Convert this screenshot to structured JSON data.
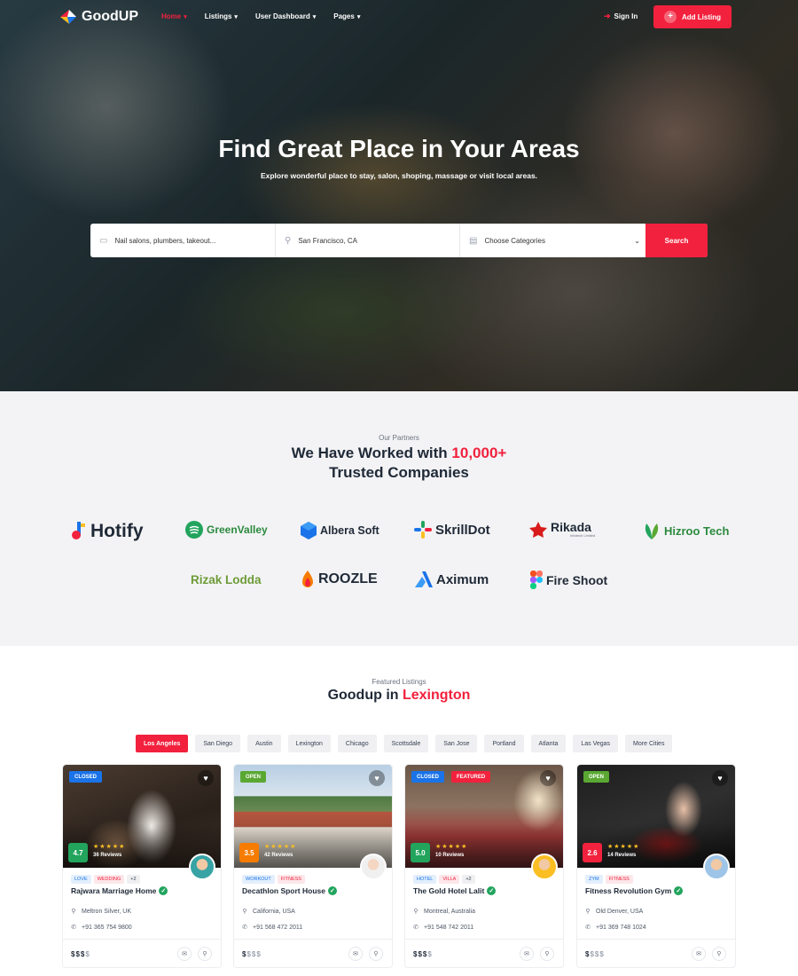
{
  "brand": {
    "name": "GoodUP"
  },
  "nav": {
    "items": [
      {
        "label": "Home",
        "active": true
      },
      {
        "label": "Listings"
      },
      {
        "label": "User Dashboard"
      },
      {
        "label": "Pages"
      }
    ],
    "signin": "Sign In",
    "add_listing": "Add Listing"
  },
  "hero": {
    "title": "Find Great Place in Your Areas",
    "subtitle": "Explore wonderful place to stay, salon, shoping, massage or visit local areas.",
    "search": {
      "keyword_placeholder": "Nail salons, plumbers, takeout...",
      "location_placeholder": "San Francisco, CA",
      "category_selected": "Choose Categories",
      "button": "Search"
    }
  },
  "partners": {
    "kicker": "Our Partners",
    "title_line1": "We Have Worked with ",
    "title_highlight": "10,000+",
    "title_line2": "Trusted Companies",
    "logos": [
      "Hotify",
      "GreenValley",
      "Albera Soft",
      "SkrillDot",
      "Rikada",
      "Hizroo Tech",
      "Rizak Lodda",
      "ROOZLE",
      "Aximum",
      "Fire Shoot"
    ],
    "rikada_sub": "Infotech Limited"
  },
  "featured": {
    "kicker": "Featured Listings",
    "title_prefix": "Goodup in ",
    "title_highlight": "Lexington",
    "tabs": [
      "Los Angeles",
      "San Diego",
      "Austin",
      "Lexington",
      "Chicago",
      "Scottsdale",
      "San Jose",
      "Portland",
      "Atlanta",
      "Las Vegas",
      "More Cities"
    ],
    "active_tab": "Los Angeles",
    "cards": [
      {
        "status": "CLOSED",
        "featured": null,
        "rating": "4.7",
        "stars": 5,
        "reviews": "36 Reviews",
        "tags": [
          "LOVE",
          "WEDDING",
          "+2"
        ],
        "name": "Rajwara Marriage Home",
        "location": "Meltron Silver, UK",
        "phone": "+91 365 754 9800",
        "price_on": "$$$",
        "price_off": "$",
        "rating_color": "#22a45d"
      },
      {
        "status": "OPEN",
        "featured": null,
        "rating": "3.5",
        "stars": 5,
        "reviews": "42 Reviews",
        "tags": [
          "WORKOUT",
          "FITNESS"
        ],
        "name": "Decathlon Sport House",
        "location": "California, USA",
        "phone": "+91 568 472 2011",
        "price_on": "$",
        "price_off": "$$$",
        "rating_color": "#f57c00"
      },
      {
        "status": "CLOSED",
        "featured": "FEATURED",
        "rating": "5.0",
        "stars": 5,
        "reviews": "10 Reviews",
        "tags": [
          "HOTEL",
          "VILLA",
          "+2"
        ],
        "name": "The Gold Hotel Lalit",
        "location": "Montreal, Australia",
        "phone": "+91 548 742 2011",
        "price_on": "$$$",
        "price_off": "$",
        "rating_color": "#22a45d"
      },
      {
        "status": "OPEN",
        "featured": null,
        "rating": "2.6",
        "stars": 5,
        "reviews": "14 Reviews",
        "tags": [
          "ZYM",
          "FITNESS"
        ],
        "name": "Fitness Revolution Gym",
        "location": "Old Denver, USA",
        "phone": "+91 369 748 1024",
        "price_on": "$",
        "price_off": "$$$",
        "rating_color": "#f2213d"
      }
    ]
  },
  "colors": {
    "accent": "#f2213d",
    "blue": "#1a73e8",
    "green": "#5aa832"
  }
}
